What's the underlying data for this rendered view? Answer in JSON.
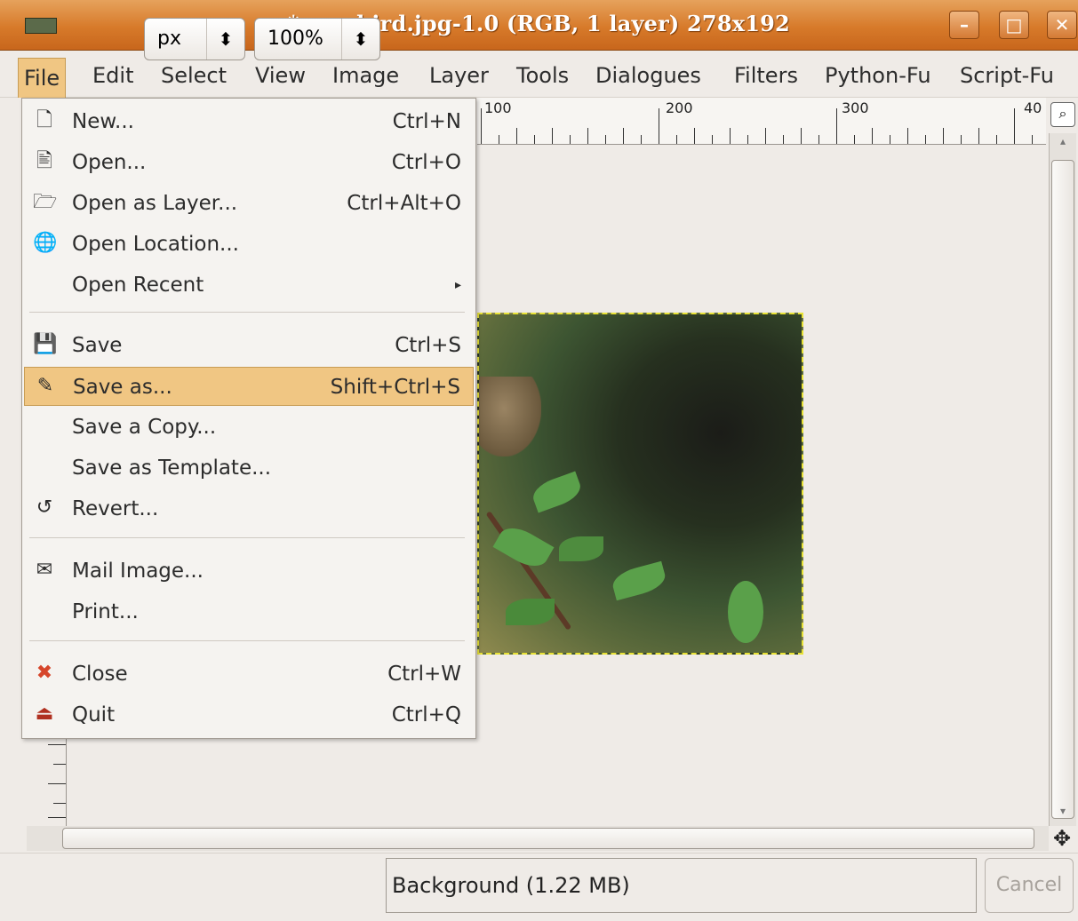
{
  "window": {
    "title": "*songbird.jpg-1.0 (RGB, 1 layer) 278x192",
    "min": "–",
    "max": "□",
    "close": "✕"
  },
  "menubar": [
    "File",
    "Edit",
    "Select",
    "View",
    "Image",
    "Layer",
    "Tools",
    "Dialogues",
    "Filters",
    "Python-Fu",
    "Script-Fu"
  ],
  "ruler": {
    "labels": [
      "100",
      "200",
      "300",
      "40"
    ]
  },
  "file_menu": {
    "items": [
      {
        "label": "New...",
        "shortcut": "Ctrl+N",
        "icon": "new-file-icon",
        "glyph": "🗋"
      },
      {
        "label": "Open...",
        "shortcut": "Ctrl+O",
        "icon": "open-icon",
        "glyph": "🖹"
      },
      {
        "label": "Open as Layer...",
        "shortcut": "Ctrl+Alt+O",
        "icon": "open-as-layer-icon",
        "glyph": "🗁"
      },
      {
        "label": "Open Location...",
        "shortcut": "",
        "icon": "globe-icon",
        "glyph": "🌐"
      },
      {
        "label": "Open Recent",
        "shortcut": "",
        "submenu": "▸"
      },
      {
        "label": "Save",
        "shortcut": "Ctrl+S",
        "icon": "save-icon",
        "glyph": "💾"
      },
      {
        "label": "Save as...",
        "shortcut": "Shift+Ctrl+S",
        "icon": "save-as-icon",
        "glyph": "✎"
      },
      {
        "label": "Save a Copy...",
        "shortcut": ""
      },
      {
        "label": "Save as Template...",
        "shortcut": ""
      },
      {
        "label": "Revert...",
        "shortcut": "",
        "icon": "revert-icon",
        "glyph": "↺"
      },
      {
        "label": "Mail Image...",
        "shortcut": "",
        "icon": "mail-icon",
        "glyph": "✉"
      },
      {
        "label": "Print...",
        "shortcut": ""
      },
      {
        "label": "Close",
        "shortcut": "Ctrl+W",
        "icon": "close-doc-icon",
        "glyph": "✖"
      },
      {
        "label": "Quit",
        "shortcut": "Ctrl+Q",
        "icon": "quit-icon",
        "glyph": "⏏"
      }
    ],
    "highlighted": "Save as..."
  },
  "status": {
    "unit": "px",
    "zoom": "100%",
    "message": "Background (1.22 MB)",
    "cancel": "Cancel"
  },
  "colors": {
    "title_bar": "#d77a2a",
    "highlight": "#f0c683",
    "selection_border": "#e8e236"
  }
}
